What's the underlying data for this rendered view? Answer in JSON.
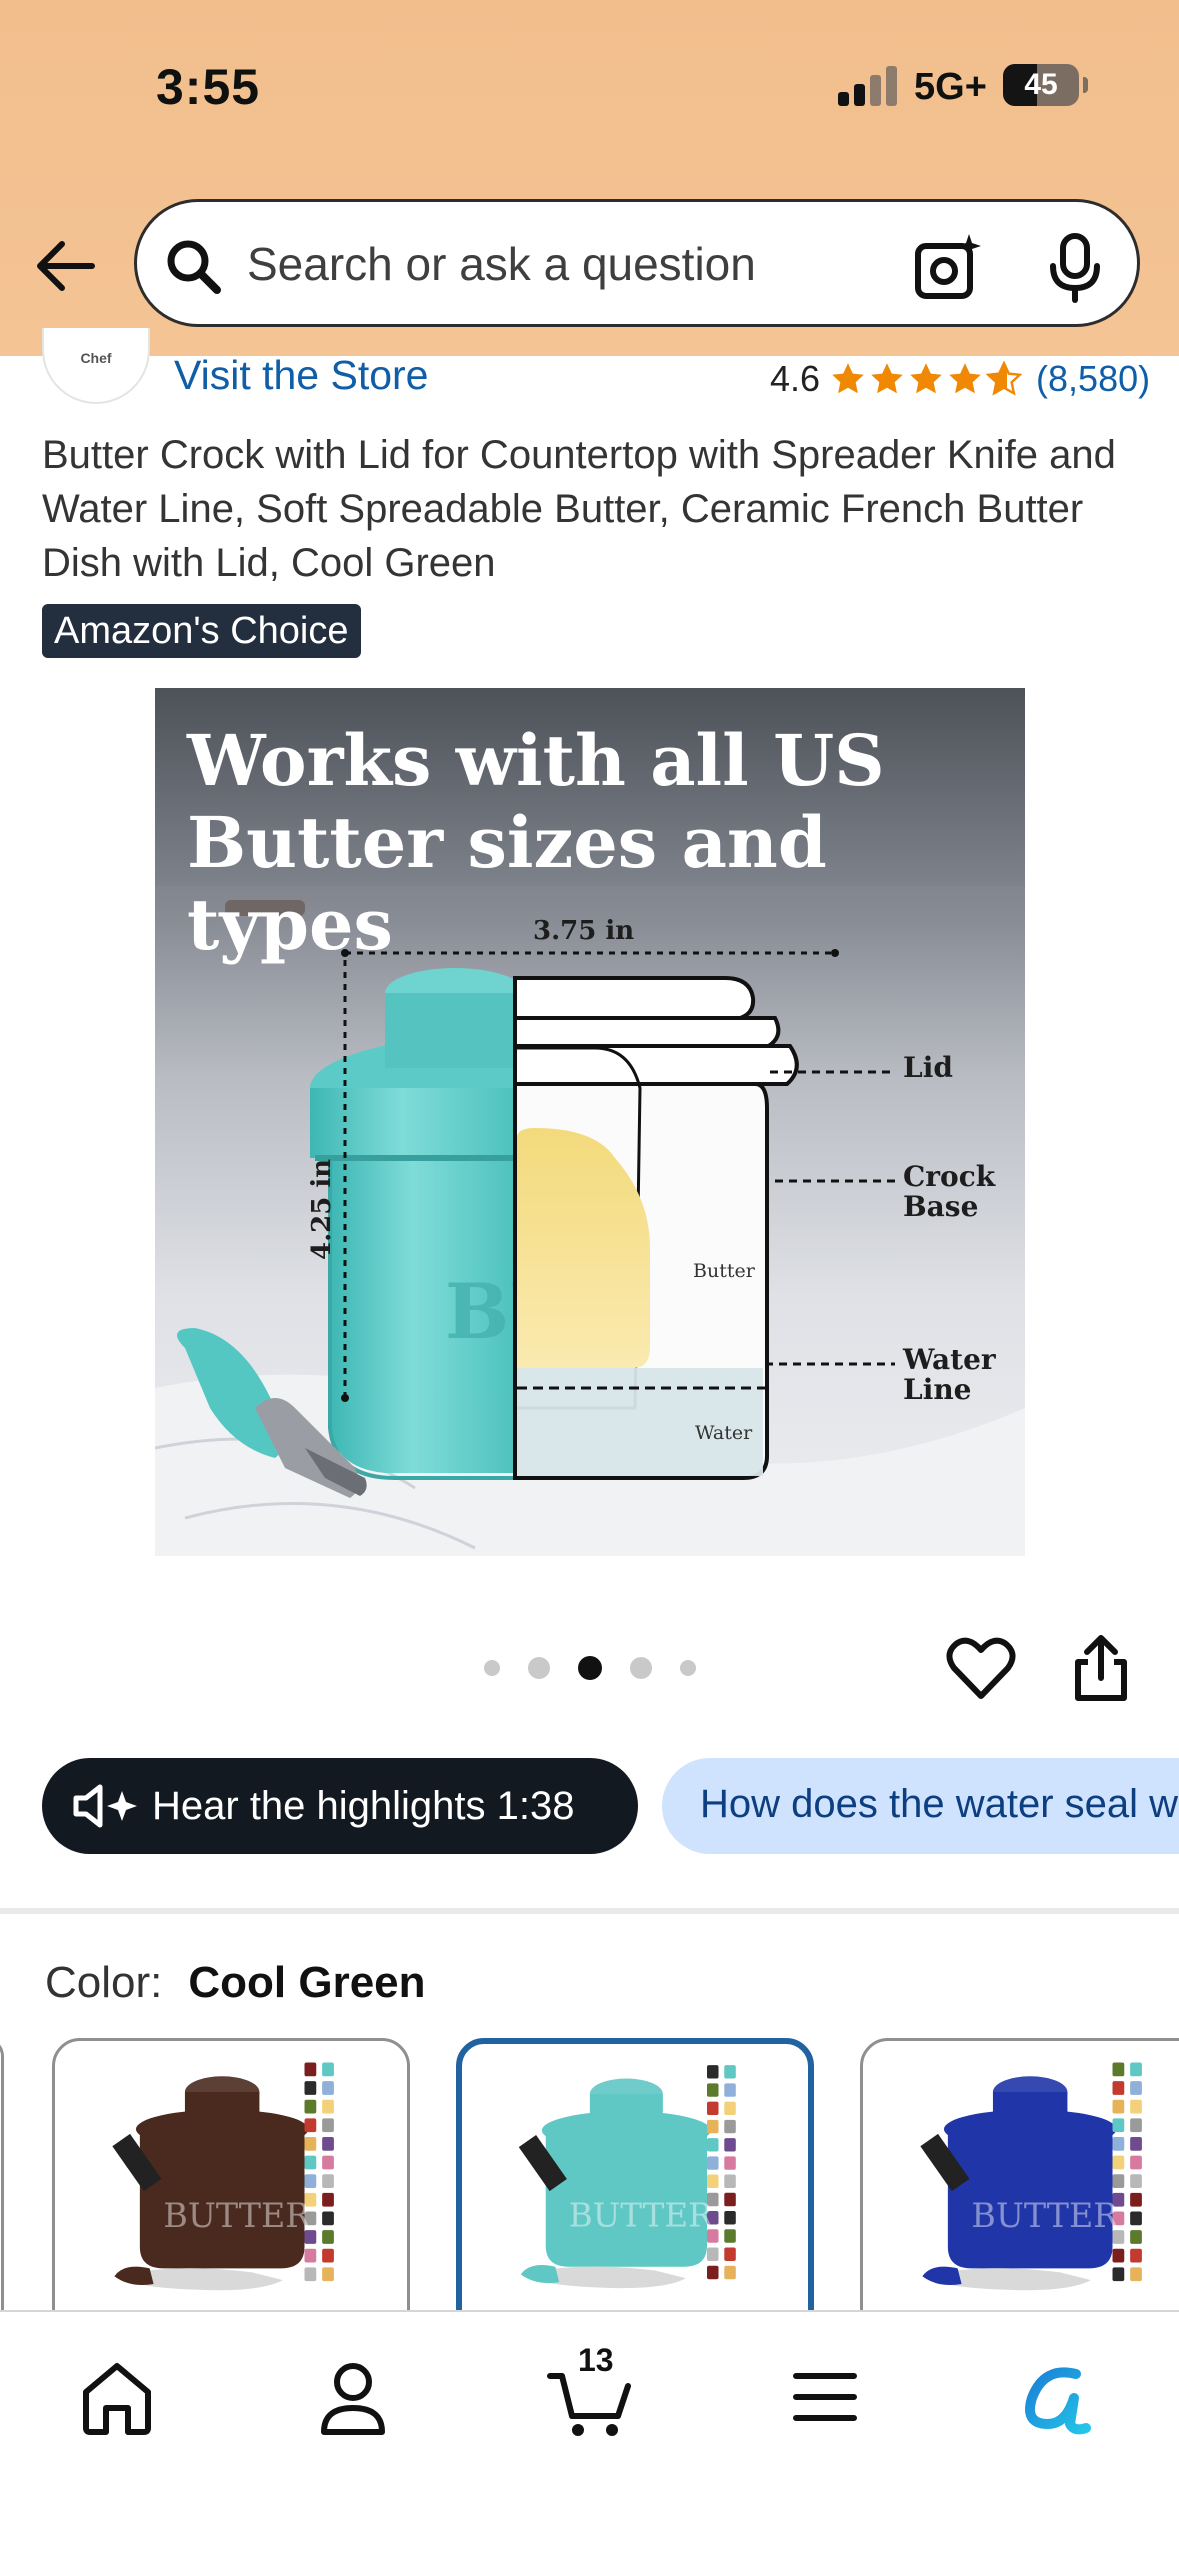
{
  "status_bar": {
    "time": "3:55",
    "network": "5G+",
    "battery": "45"
  },
  "search": {
    "placeholder": "Search or ask a question"
  },
  "product": {
    "visit_store": "Visit the Store",
    "rating": "4.6",
    "rating_stars": 4.6,
    "rating_count": "(8,580)",
    "title": "Butter Crock with Lid for Countertop with Spreader Knife and Water Line, Soft Spreadable Butter, Ceramic French Butter Dish with Lid, Cool Green",
    "badge": "Amazon's Choice"
  },
  "hero_image": {
    "headline_line1": "Works with all US",
    "headline_line2": "Butter sizes and types",
    "width_label": "3.75 in",
    "height_label": "4.25 in",
    "embossed_text": "BUTT",
    "parts": {
      "lid": "Lid",
      "crock_line1": "Crock",
      "crock_line2": "Base",
      "water_line1": "Water",
      "water_line2": "Line"
    },
    "inner": {
      "butter": "Butter",
      "water": "Water"
    }
  },
  "carousel": {
    "dot_count": 5,
    "active_index": 2
  },
  "chips": {
    "highlights": "Hear the highlights 1:38",
    "question": "How does the water seal work?"
  },
  "color": {
    "label": "Color:",
    "selected": "Cool Green",
    "swatch_embossed": "BUTTER",
    "options": [
      {
        "name": "brown",
        "color": "#4a2a1f"
      },
      {
        "name": "cool-green",
        "color": "#5fc7c4"
      },
      {
        "name": "blue",
        "color": "#1f35a8"
      }
    ]
  },
  "tabbar": {
    "cart_count": "13"
  },
  "colors": {
    "header_bg": "#f3c191",
    "link_blue": "#0f5ea8",
    "star_orange": "#f08804",
    "badge_bg": "#232f3e",
    "chip_light_bg": "#cfe3ff",
    "selected_border": "#2162a1",
    "rufus_blue": "#1aa3e8"
  }
}
